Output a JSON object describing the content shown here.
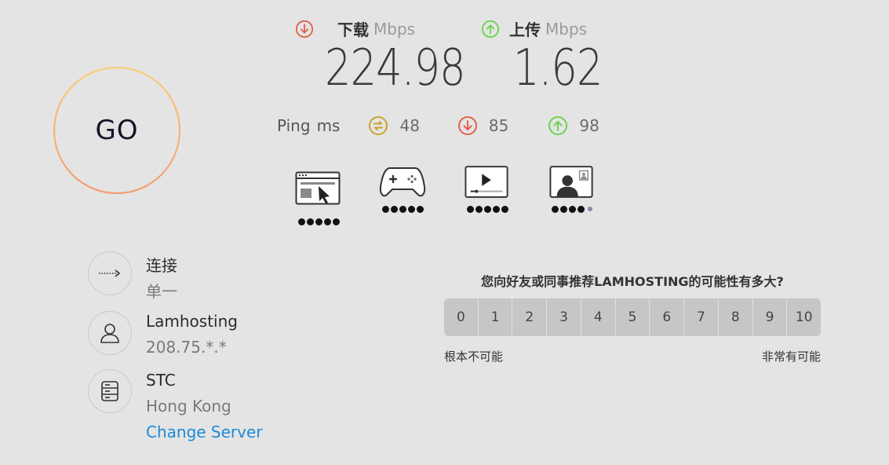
{
  "go": {
    "label": "GO"
  },
  "download": {
    "name": "下载",
    "unit": "Mbps",
    "value": "224.98",
    "color": "#e3604a"
  },
  "upload": {
    "name": "上传",
    "unit": "Mbps",
    "value": "1.62",
    "color": "#6dd34c"
  },
  "ping": {
    "label": "Ping",
    "unit": "ms",
    "idle": "48",
    "download": "85",
    "upload": "98",
    "idle_color": "#c9a42b"
  },
  "usage": [
    {
      "icon": "web-browsing-icon",
      "rating": 5,
      "max": 5
    },
    {
      "icon": "gaming-icon",
      "rating": 5,
      "max": 5
    },
    {
      "icon": "video-streaming-icon",
      "rating": 5,
      "max": 5
    },
    {
      "icon": "video-chat-icon",
      "rating": 4,
      "max": 5
    }
  ],
  "connection": {
    "title": "连接",
    "value": "单一"
  },
  "isp": {
    "name": "Lamhosting",
    "ip": "208.75.*.*"
  },
  "server": {
    "name": "STC",
    "location": "Hong Kong",
    "change_label": "Change Server"
  },
  "survey": {
    "question": "您向好友或同事推荐LAMHOSTING的可能性有多大?",
    "scale": [
      "0",
      "1",
      "2",
      "3",
      "4",
      "5",
      "6",
      "7",
      "8",
      "9",
      "10"
    ],
    "low_label": "根本不可能",
    "high_label": "非常有可能"
  }
}
